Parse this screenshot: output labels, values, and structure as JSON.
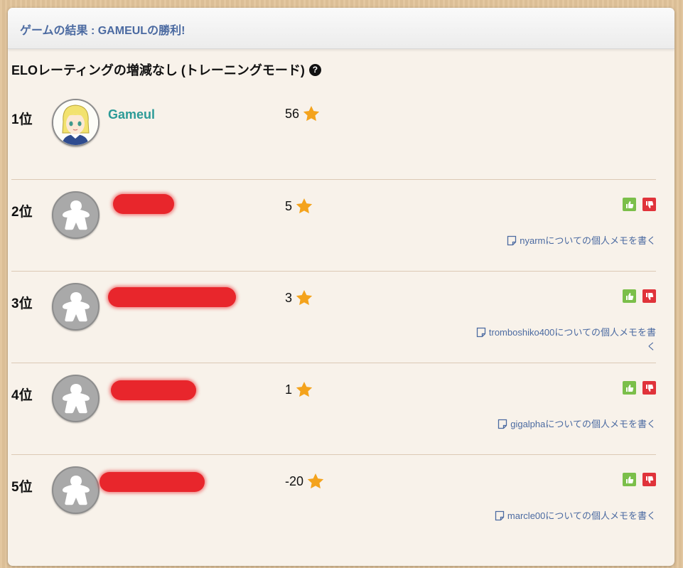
{
  "panel": {
    "title": "ゲームの結果 : GAMEULの勝利!"
  },
  "mode": {
    "text": "ELOレーティングの増減なし (トレーニングモード)",
    "help_icon": "question-circle-icon"
  },
  "players": [
    {
      "rank": "1位",
      "name": "Gameul",
      "score": "56",
      "avatar": "anime-character-avatar",
      "memo": ""
    },
    {
      "rank": "2位",
      "name": "",
      "score": "5",
      "avatar": "meeple-avatar",
      "memo": "nyarmについての個人メモを書く"
    },
    {
      "rank": "3位",
      "name": "",
      "score": "3",
      "avatar": "meeple-avatar",
      "memo": "tromboshiko400についての個人メモを書く"
    },
    {
      "rank": "4位",
      "name": "",
      "score": "1",
      "avatar": "meeple-avatar",
      "memo": "gigalphaについての個人メモを書く"
    },
    {
      "rank": "5位",
      "name": "",
      "score": "-20",
      "avatar": "meeple-avatar",
      "memo": "marcle00についての個人メモを書く"
    }
  ],
  "colors": {
    "accent_blue": "#4b6aa1",
    "winner_name": "#2c9b97",
    "star": "#f4a31c",
    "thumb_up": "#7bbf4a",
    "thumb_down": "#e0333a"
  }
}
